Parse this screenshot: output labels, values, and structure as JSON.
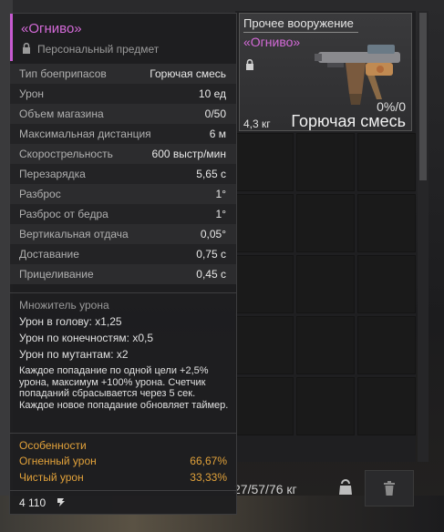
{
  "tooltip": {
    "title": "«Огниво»",
    "subtitle": "Персональный предмет",
    "stats": [
      {
        "label": "Тип боеприпасов",
        "value": "Горючая смесь"
      },
      {
        "label": "Урон",
        "value": "10 ед"
      },
      {
        "label": "Объем магазина",
        "value": "0/50"
      },
      {
        "label": "Максимальная дистанция",
        "value": "6 м"
      },
      {
        "label": "Скорострельность",
        "value": "600 выстр/мин"
      },
      {
        "label": "Перезарядка",
        "value": "5,65 с"
      },
      {
        "label": "Разброс",
        "value": "1°"
      },
      {
        "label": "Разброс от бедра",
        "value": "1°"
      },
      {
        "label": "Вертикальная отдача",
        "value": "0,05°"
      },
      {
        "label": "Доставание",
        "value": "0,75 с"
      },
      {
        "label": "Прицеливание",
        "value": "0,45 с"
      }
    ],
    "damage_multiplier": {
      "title": "Множитель урона",
      "head": "Урон в голову: x1,25",
      "limbs": "Урон по конечностям: x0,5",
      "mutants": "Урон по мутантам: x2"
    },
    "description": "Каждое попадание по одной цели +2,5% урона, максимум +100% урона. Счетчик попаданий сбрасывается через 5 сек. Каждое новое попадание обновляет таймер.",
    "features": {
      "title": "Особенности",
      "rows": [
        {
          "label": "Огненный урон",
          "value": "66,67%"
        },
        {
          "label": "Чистый урон",
          "value": "33,33%"
        }
      ]
    },
    "price": "4 110"
  },
  "item_card": {
    "category": "Прочее вооружение",
    "name": "«Огниво»",
    "ammo": "0%/0",
    "weight": "4,3 кг",
    "ammo_type": "Горючая смесь"
  },
  "inventory": {
    "weight_total": "27/57/76 кг"
  },
  "colors": {
    "accent": "#d46ad8",
    "feature": "#e2a23a"
  }
}
